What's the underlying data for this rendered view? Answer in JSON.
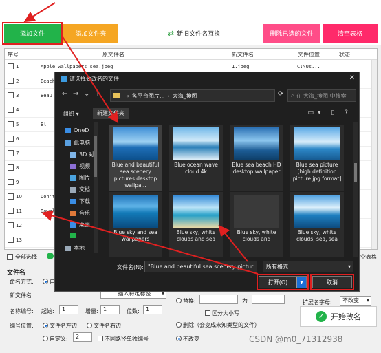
{
  "toolbar": {
    "add_file": "添加文件",
    "add_folder": "添加文件夹",
    "swap_names": "新旧文件名互换",
    "delete_selected": "删除已选的文件",
    "clear_table": "清空表格"
  },
  "table": {
    "headers": [
      "序号",
      "原文件名",
      "新文件名",
      "文件位置",
      "状态"
    ],
    "rows": [
      {
        "num": "1",
        "orig": "Apple wallpapers sea.jpeg",
        "new": "1.jpeg",
        "loc": "C:\\Us..."
      },
      {
        "num": "2",
        "orig": "Beach",
        "new": "",
        "loc": ""
      },
      {
        "num": "3",
        "orig": "Beau",
        "new": "",
        "loc": ""
      },
      {
        "num": "4",
        "orig": "",
        "new": "",
        "loc": ""
      },
      {
        "num": "5",
        "orig": "Bl",
        "new": "",
        "loc": ""
      },
      {
        "num": "6",
        "orig": "",
        "new": "",
        "loc": ""
      },
      {
        "num": "7",
        "orig": "",
        "new": "",
        "loc": ""
      },
      {
        "num": "8",
        "orig": "",
        "new": "",
        "loc": ""
      },
      {
        "num": "9",
        "orig": "",
        "new": "",
        "loc": ""
      },
      {
        "num": "10",
        "orig": "Don't",
        "new": "",
        "loc": ""
      },
      {
        "num": "11",
        "orig": "Downl",
        "new": "",
        "loc": ""
      },
      {
        "num": "12",
        "orig": "",
        "new": "",
        "loc": ""
      },
      {
        "num": "13",
        "orig": "",
        "new": "",
        "loc": ""
      }
    ]
  },
  "bottom": {
    "select_all": "全部选择",
    "clear_table_short": "空表格",
    "section_filename": "文件名",
    "naming_mode": "命名方式:",
    "naming_mode_value": "自",
    "new_filename": "新文件名:",
    "insert_placeholder": "插入特定标签",
    "name_numbering": "名称编号:",
    "start": "起始:",
    "start_value": "1",
    "increment": "增量:",
    "increment_value": "1",
    "digits": "位数:",
    "digits_value": "1",
    "number_position": "编号位置:",
    "pos_left": "文件名左边",
    "pos_right": "文件名右边",
    "custom": "自定义:",
    "custom_value": "2",
    "separate_path": "不同路径单独编号",
    "replace": "替换:",
    "to": "为",
    "case_sensitive": "区分大小写",
    "delete_ext": "删除（会变成未知类型的文件）",
    "no_change": "不改变",
    "ext_case": "扩展名字母:",
    "ext_case_value": "不改变",
    "start_rename": "开始改名"
  },
  "dialog": {
    "title": "请选择要改名的文件",
    "breadcrumb": [
      "各平台图片...",
      "大海_搜图"
    ],
    "search_placeholder": "在 大海_搜图 中搜索",
    "organize": "组织 ▾",
    "new_folder": "新建文件夹",
    "nav_items": [
      "OneD",
      "此电脑",
      "3D 对",
      "视频",
      "图片",
      "文档",
      "下载",
      "音乐",
      "桌面",
      "",
      "本地"
    ],
    "files": [
      {
        "caption": "Blue and beautiful sea scenery pictures desktop wallpa...",
        "selected": true
      },
      {
        "caption": "Blue ocean wave cloud 4k",
        "selected": false
      },
      {
        "caption": "Blue sea beach HD desktop wallpaper",
        "selected": false
      },
      {
        "caption": "Blue sea picture [high definition picture jpg format]",
        "selected": false
      },
      {
        "caption": "Blue sky and sea wallpapers",
        "selected": false
      },
      {
        "caption": "Blue sky, white clouds and sea",
        "selected": false
      },
      {
        "caption": "Blue sky, white clouds and",
        "selected": false
      },
      {
        "caption": "Blue sky, white clouds, sea, sea",
        "selected": false
      }
    ],
    "filename_label": "文件名(N):",
    "filename_value": "\"Blue and beautiful sea scenery pictur",
    "filetype": "所有格式",
    "open": "打开(O)",
    "cancel": "取消"
  },
  "watermark": "CSDN @m0_71312938"
}
